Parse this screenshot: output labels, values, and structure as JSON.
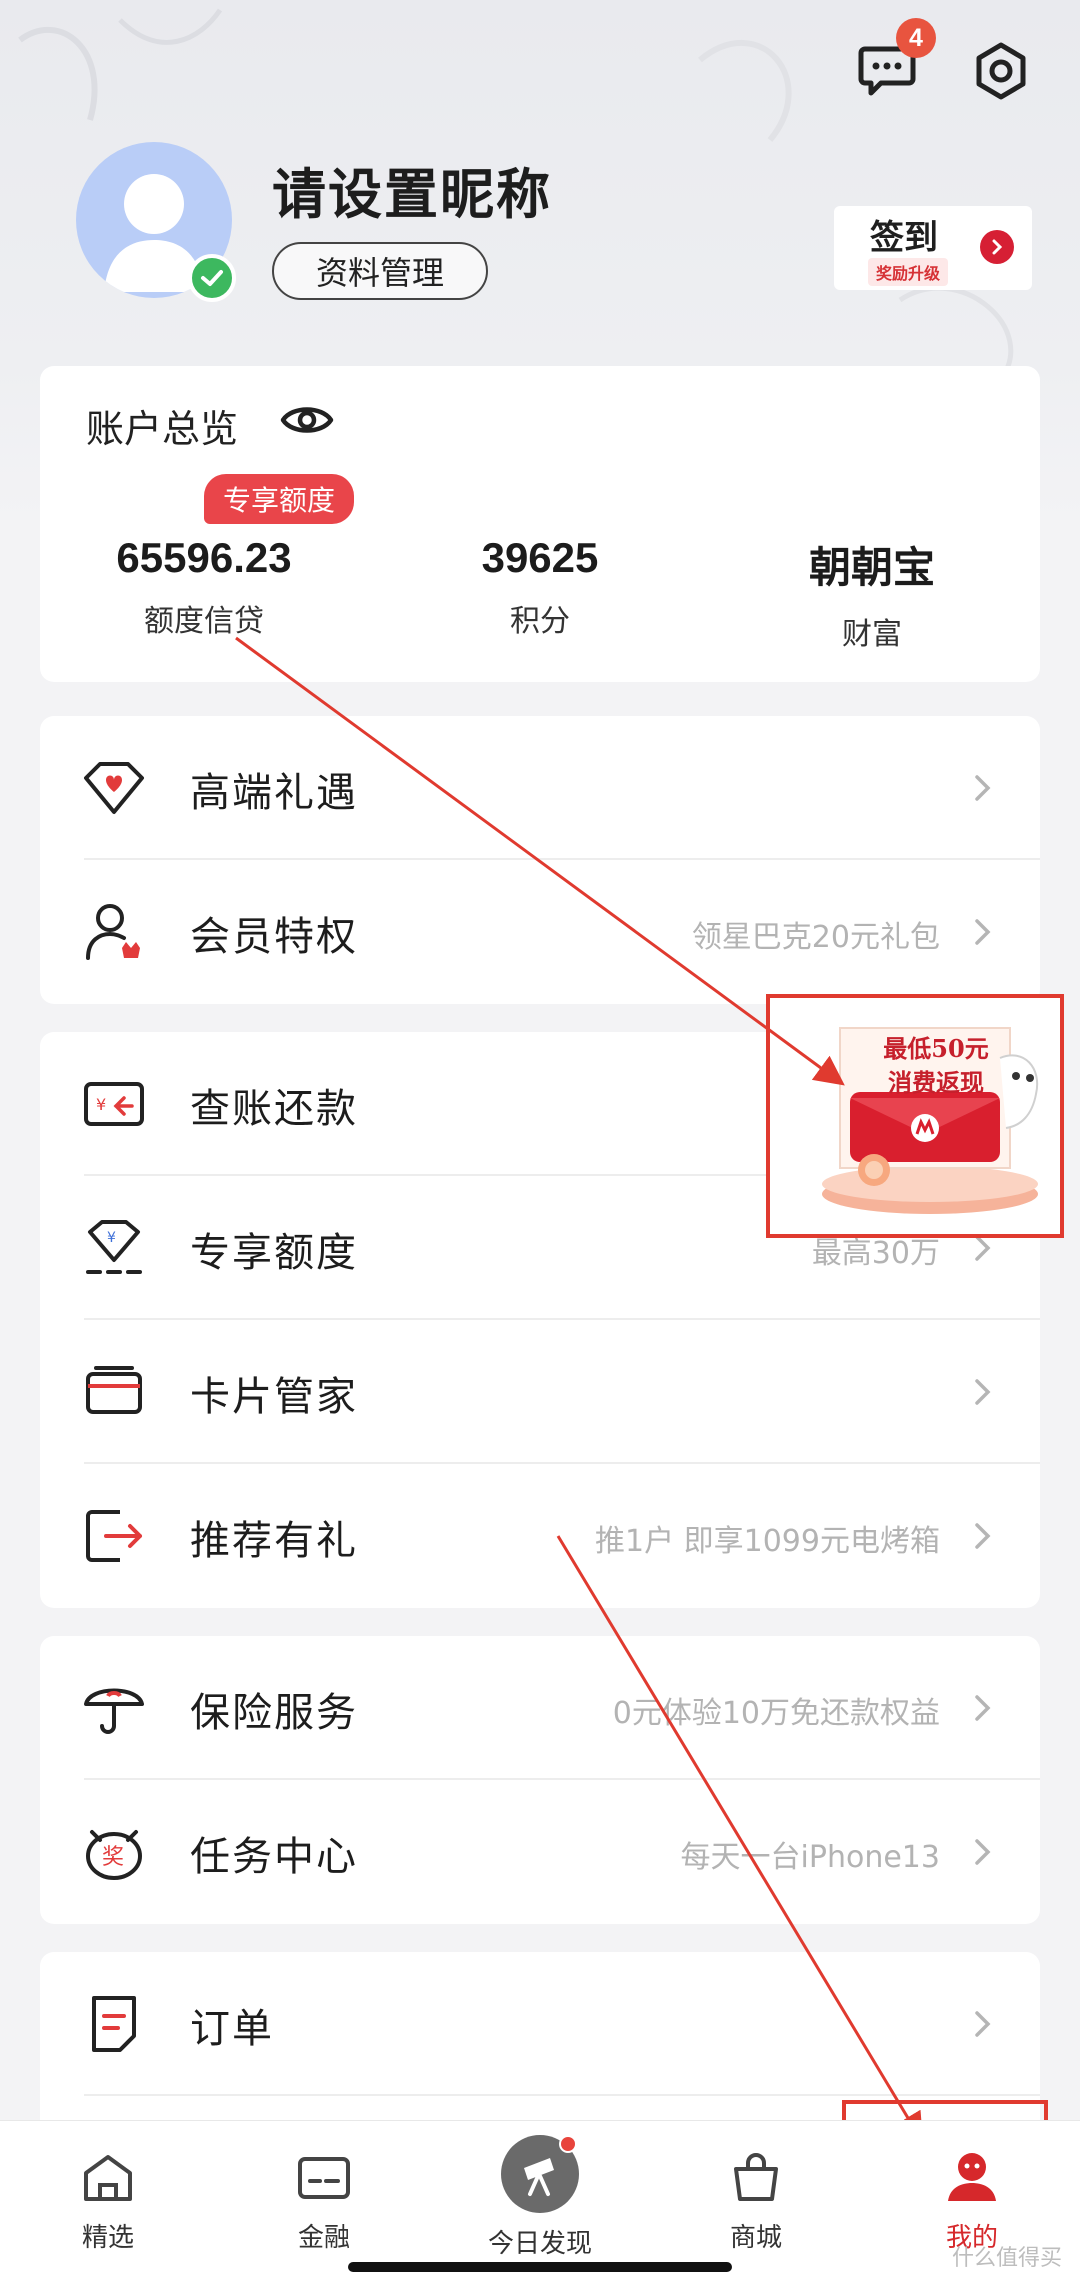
{
  "header": {
    "message_badge_count": "4"
  },
  "profile": {
    "nickname": "请设置昵称",
    "manage_button": "资料管理",
    "checkin_title": "签到",
    "checkin_subtitle": "奖励升级"
  },
  "overview": {
    "title": "账户总览",
    "badge": "专享额度",
    "items": [
      {
        "value": "65596.23",
        "label": "额度信贷"
      },
      {
        "value": "39625",
        "label": "积分"
      },
      {
        "value": "朝朝宝",
        "label": "财富"
      }
    ]
  },
  "menu_groups": [
    [
      {
        "icon": "diamond-heart-icon",
        "label": "高端礼遇",
        "hint": ""
      },
      {
        "icon": "member-crown-icon",
        "label": "会员特权",
        "hint": "领星巴克20元礼包"
      }
    ],
    [
      {
        "icon": "bill-repay-icon",
        "label": "查账还款",
        "hint": ""
      },
      {
        "icon": "exclusive-credit-icon",
        "label": "专享额度",
        "hint": "最高30万"
      },
      {
        "icon": "card-icon",
        "label": "卡片管家",
        "hint": ""
      },
      {
        "icon": "recommend-icon",
        "label": "推荐有礼",
        "hint": "推1户 即享1099元电烤箱"
      }
    ],
    [
      {
        "icon": "umbrella-icon",
        "label": "保险服务",
        "hint": "0元体验10万免还款权益"
      },
      {
        "icon": "task-reward-icon",
        "label": "任务中心",
        "hint": "每天一台iPhone13"
      }
    ],
    [
      {
        "icon": "order-icon",
        "label": "订单",
        "hint": ""
      }
    ]
  ],
  "promo": {
    "line1": "最低50元",
    "line2": "消费返现"
  },
  "bottom_nav": [
    {
      "icon": "home-icon",
      "label": "精选",
      "active": false
    },
    {
      "icon": "finance-card-icon",
      "label": "金融",
      "active": false
    },
    {
      "icon": "telescope-icon",
      "label": "今日发现",
      "active": false
    },
    {
      "icon": "shopping-bag-icon",
      "label": "商城",
      "active": false
    },
    {
      "icon": "profile-icon",
      "label": "我的",
      "active": true
    }
  ],
  "watermark": "什么值得买",
  "colors": {
    "accent": "#d6282b",
    "annotation": "#e03a2f",
    "badge": "#e9454a"
  }
}
